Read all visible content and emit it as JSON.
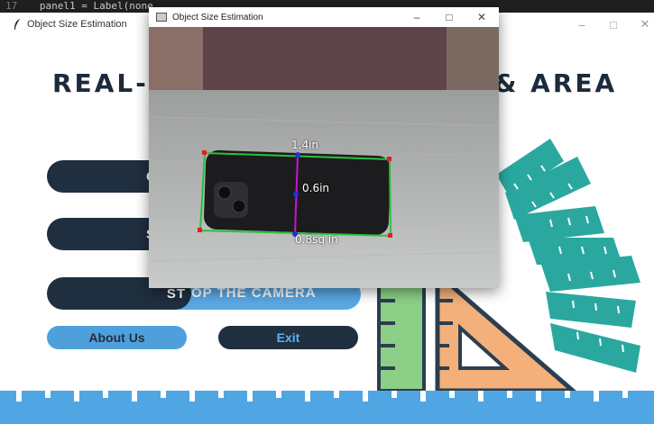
{
  "background_code": {
    "line_number": "17",
    "code": "panel1 = Label(none,"
  },
  "app_window": {
    "title": "Object Size Estimation",
    "controls": [
      "–",
      "□",
      "✕"
    ],
    "heading_left": "REAL-",
    "heading_right": "& AREA",
    "buttons": {
      "check_label": "CH",
      "start_label": "ST",
      "stop_left": "ST",
      "stop_right": "OP THE CAMERA",
      "about_label": "About Us",
      "exit_label": "Exit"
    }
  },
  "camera_window": {
    "title": "Object Size Estimation",
    "controls": [
      "–",
      "□",
      "✕"
    ],
    "measurements": {
      "length": "1.4in",
      "width": "0.6in",
      "area": "0.8sq in"
    }
  },
  "colors": {
    "navy": "#1f2f3f",
    "blue": "#4f9fdc",
    "teal": "#2aa8a0",
    "orange": "#f4b07a",
    "green": "#8ccf86",
    "measure_box": "#28c23a",
    "measure_line": "#c814d0"
  }
}
